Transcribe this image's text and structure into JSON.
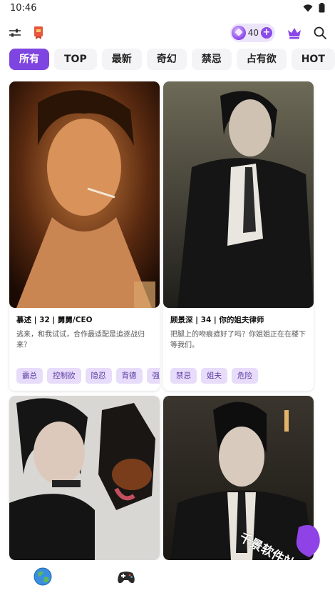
{
  "status_bar": {
    "time": "10:46",
    "icons": [
      "wifi-icon",
      "battery-icon"
    ]
  },
  "top_bar": {
    "left_icons": [
      "filter-sliders-icon",
      "bookmark-flag-icon"
    ],
    "gem_count": "40",
    "right_icons": [
      "crown-icon",
      "search-icon"
    ]
  },
  "tabs": [
    "所有",
    "TOP",
    "最新",
    "奇幻",
    "禁忌",
    "占有欲",
    "HOT"
  ],
  "active_tab": "所有",
  "cards": [
    {
      "title": "慕述 | 32 | 舅舅/CEO",
      "description": "逃来，和我试试，合作最适配是追逐战归来？",
      "tags": [
        "霸总",
        "控制欲",
        "隐忍",
        "背德",
        "强"
      ]
    },
    {
      "title": "顾景深 | 34 | 你的姐夫律师",
      "description": "把腿上的吻痕遮好了吗？你姐姐正在在楼下等我们。",
      "tags": [
        "禁忌",
        "姐夫",
        "危险"
      ]
    },
    {
      "title": "",
      "description": "",
      "tags": []
    },
    {
      "title": "",
      "description": "",
      "tags": []
    }
  ],
  "bottom_nav": [
    "globe-icon",
    "gamepad-icon"
  ],
  "watermark_text": "千景软件站",
  "colors": {
    "accent": "#7f45e0",
    "tag_bg": "#e8dcfb",
    "tag_text": "#5a3ca0"
  }
}
